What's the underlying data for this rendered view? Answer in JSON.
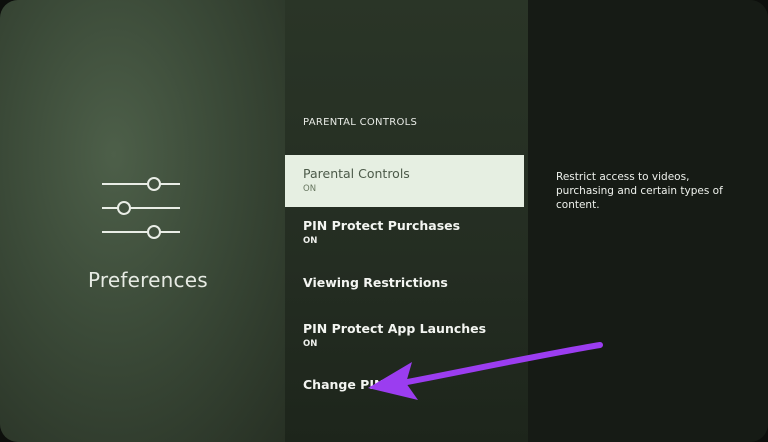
{
  "left_panel": {
    "category_title": "Preferences",
    "icon": "sliders-icon"
  },
  "menu": {
    "section_header": "PARENTAL CONTROLS",
    "items": [
      {
        "label": "Parental Controls",
        "status": "ON",
        "selected": true
      },
      {
        "label": "PIN Protect Purchases",
        "status": "ON",
        "selected": false
      },
      {
        "label": "Viewing Restrictions",
        "status": "",
        "selected": false
      },
      {
        "label": "PIN Protect App Launches",
        "status": "ON",
        "selected": false
      },
      {
        "label": "Change PIN",
        "status": "",
        "selected": false
      }
    ]
  },
  "description": {
    "text": "Restrict access to videos, purchasing and certain types of content."
  },
  "annotation": {
    "arrow_color": "#9b3df0",
    "points_to": "Change PIN"
  },
  "colors": {
    "selected_bg": "#e6efe2",
    "left_panel_bg": "#3b4a38",
    "menu_bg": "#262f23",
    "description_bg": "#161b15"
  }
}
